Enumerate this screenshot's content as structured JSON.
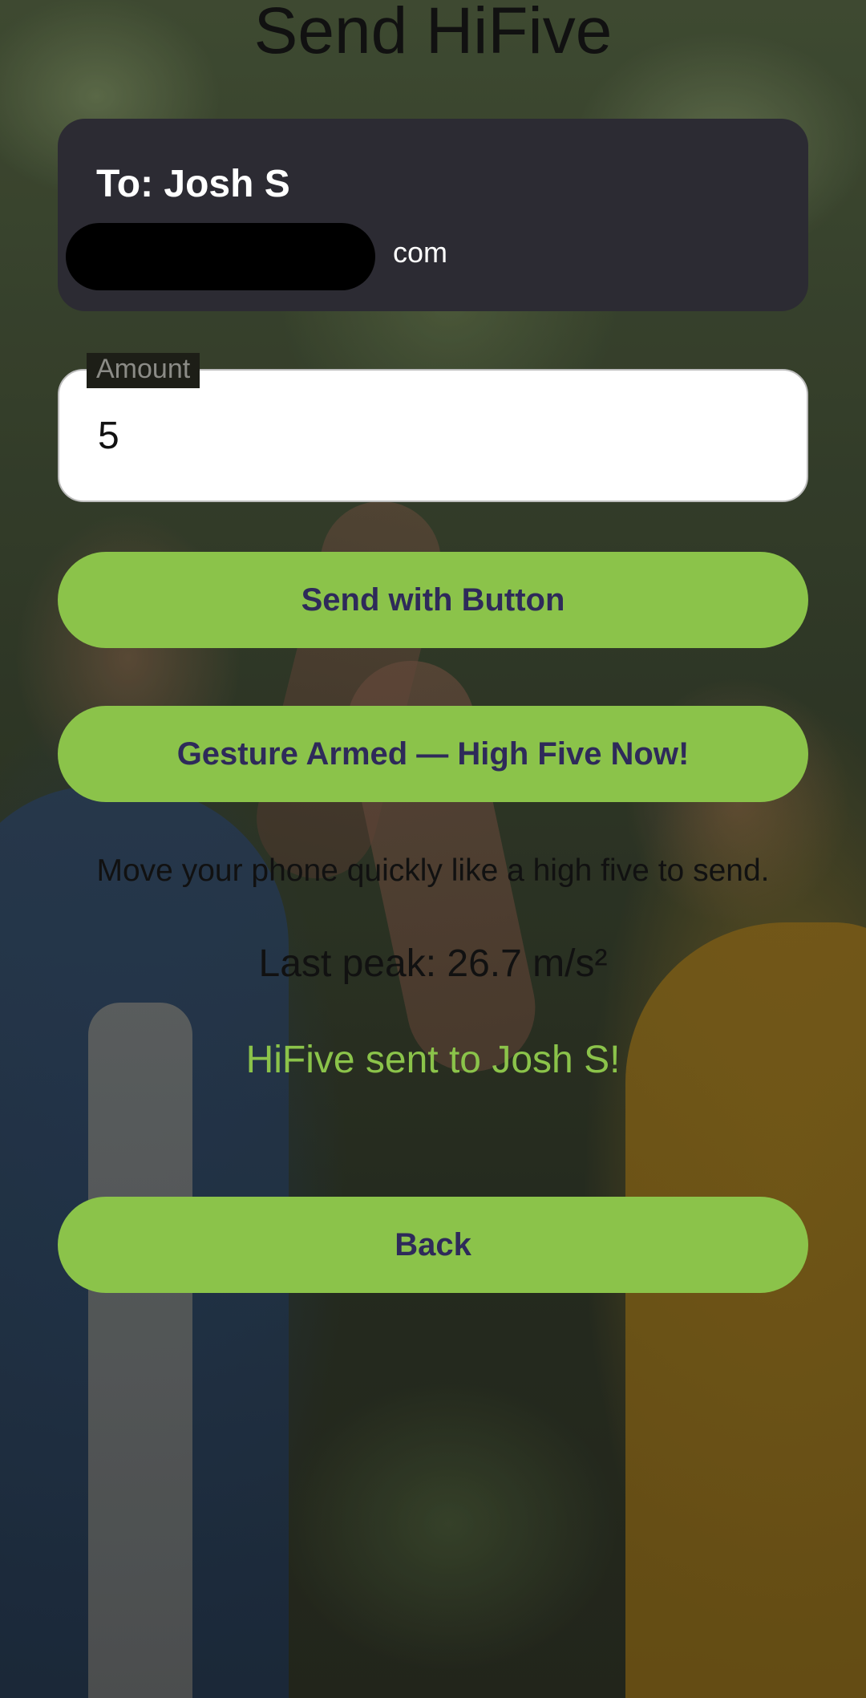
{
  "page": {
    "title": "Send HiFive"
  },
  "recipient": {
    "name_line": "To: Josh S",
    "email_suffix": "com"
  },
  "amount": {
    "label": "Amount",
    "value": "5"
  },
  "buttons": {
    "send_with_button": "Send with Button",
    "gesture": "Gesture Armed — High Five Now!",
    "back": "Back"
  },
  "hint_text": "Move your phone quickly like a high five to send.",
  "peak_text": "Last peak: 26.7 m/s²",
  "status_text": "HiFive sent to Josh S!",
  "colors": {
    "accent_green": "#8bc34a",
    "button_text": "#2e2a5a",
    "card_background": "#2c2b33"
  }
}
